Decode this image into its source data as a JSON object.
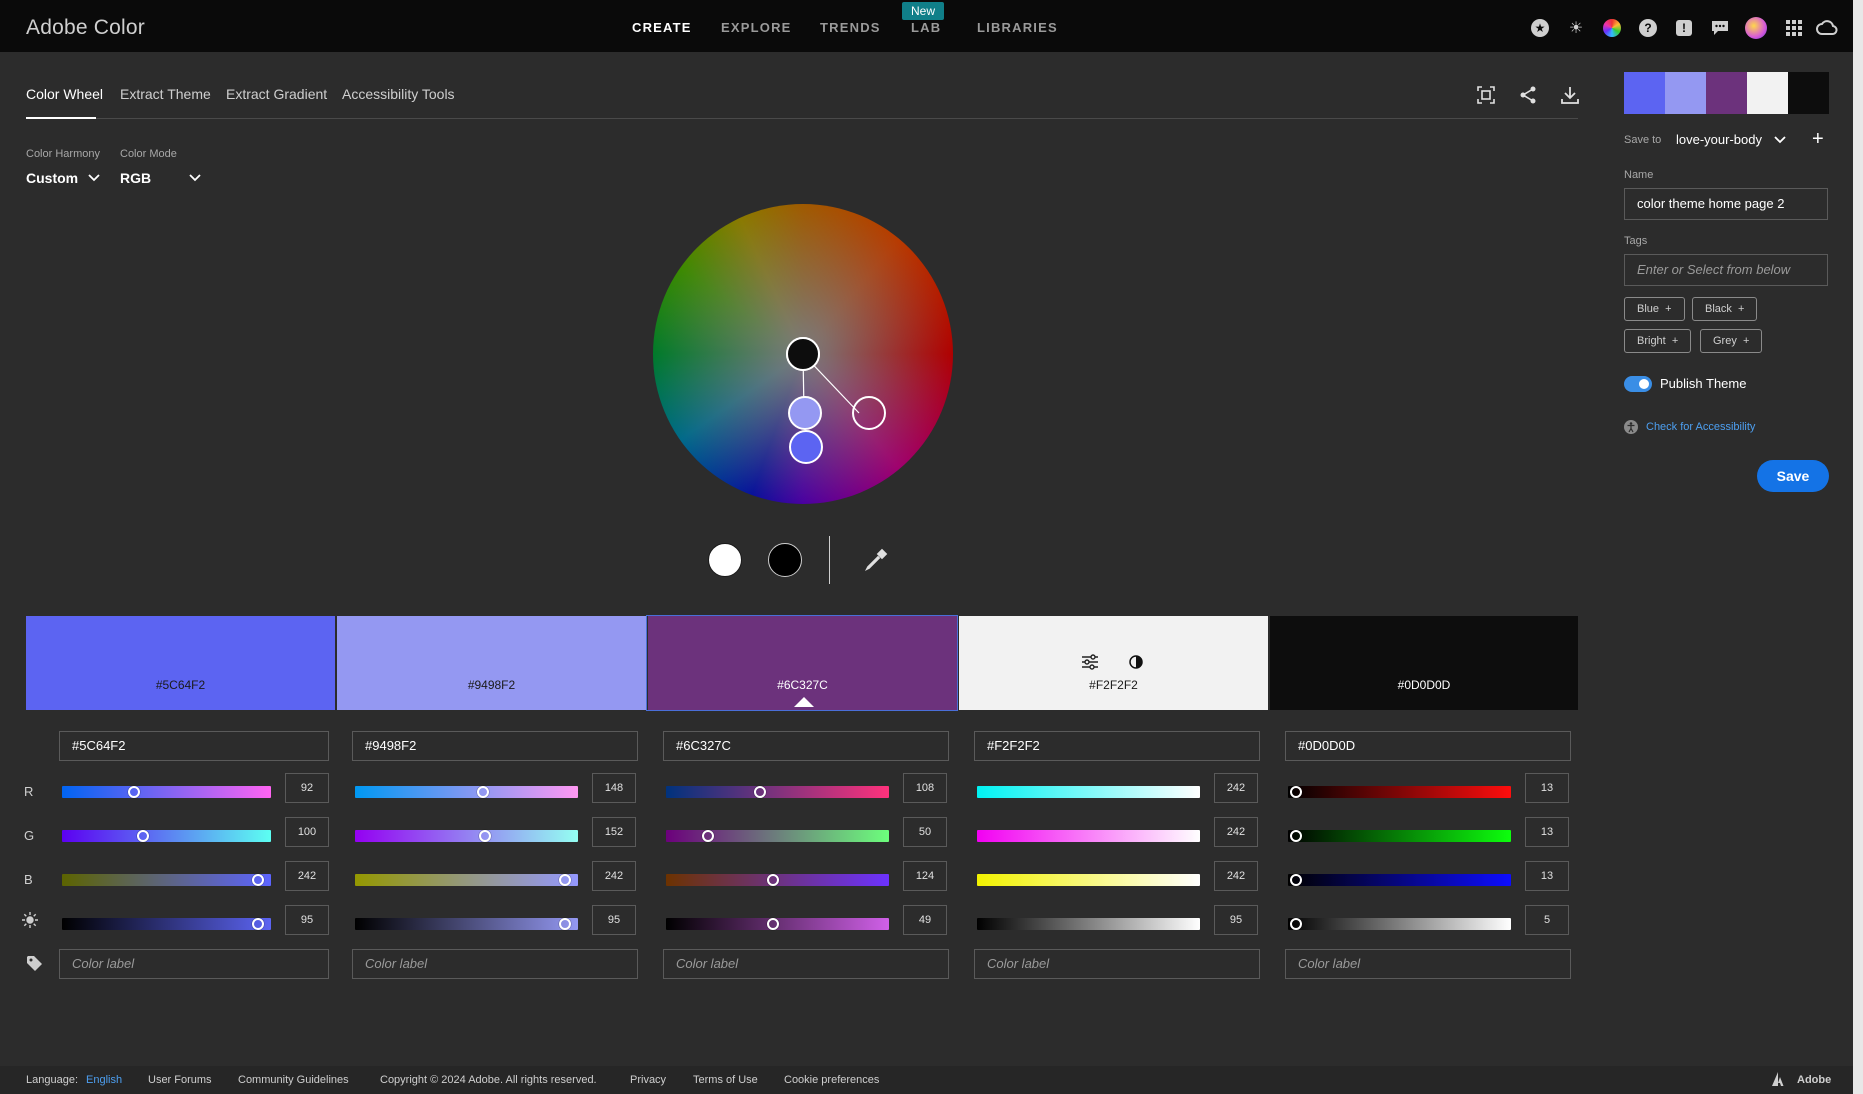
{
  "app": {
    "title": "Adobe Color"
  },
  "nav": {
    "create": "CREATE",
    "explore": "EXPLORE",
    "trends": "TRENDS",
    "lab": "LAB",
    "libraries": "LIBRARIES",
    "new_badge": "New"
  },
  "tabs": {
    "color_wheel": "Color Wheel",
    "extract_theme": "Extract Theme",
    "extract_gradient": "Extract Gradient",
    "accessibility_tools": "Accessibility Tools"
  },
  "harmony": {
    "label": "Color Harmony",
    "value": "Custom"
  },
  "mode": {
    "label": "Color Mode",
    "value": "RGB"
  },
  "swatches": [
    {
      "hex": "#5C64F2",
      "r": 92,
      "g": 100,
      "b": 242,
      "brightness": 95,
      "label_placeholder": "Color label"
    },
    {
      "hex": "#9498F2",
      "r": 148,
      "g": 152,
      "b": 242,
      "brightness": 95,
      "label_placeholder": "Color label"
    },
    {
      "hex": "#6C327C",
      "r": 108,
      "g": 50,
      "b": 124,
      "brightness": 49,
      "label_placeholder": "Color label"
    },
    {
      "hex": "#F2F2F2",
      "r": 242,
      "g": 242,
      "b": 242,
      "brightness": 95,
      "label_placeholder": "Color label"
    },
    {
      "hex": "#0D0D0D",
      "r": 13,
      "g": 13,
      "b": 13,
      "brightness": 5,
      "label_placeholder": "Color label"
    }
  ],
  "rows": {
    "r": "R",
    "g": "G",
    "b": "B"
  },
  "panel": {
    "save_to_label": "Save to",
    "library": "love-your-body",
    "name_label": "Name",
    "name_value": "color theme home page 2",
    "tags_label": "Tags",
    "tags_placeholder": "Enter or Select from below",
    "tags": [
      "Blue",
      "Black",
      "Bright",
      "Grey"
    ],
    "publish": "Publish Theme",
    "check_accessibility": "Check for Accessibility",
    "save": "Save"
  },
  "footer": {
    "language_label": "Language:",
    "language": "English",
    "user_forums": "User Forums",
    "community": "Community Guidelines",
    "copyright": "Copyright © 2024 Adobe. All rights reserved.",
    "privacy": "Privacy",
    "terms": "Terms of Use",
    "cookies": "Cookie preferences",
    "adobe": "Adobe"
  }
}
